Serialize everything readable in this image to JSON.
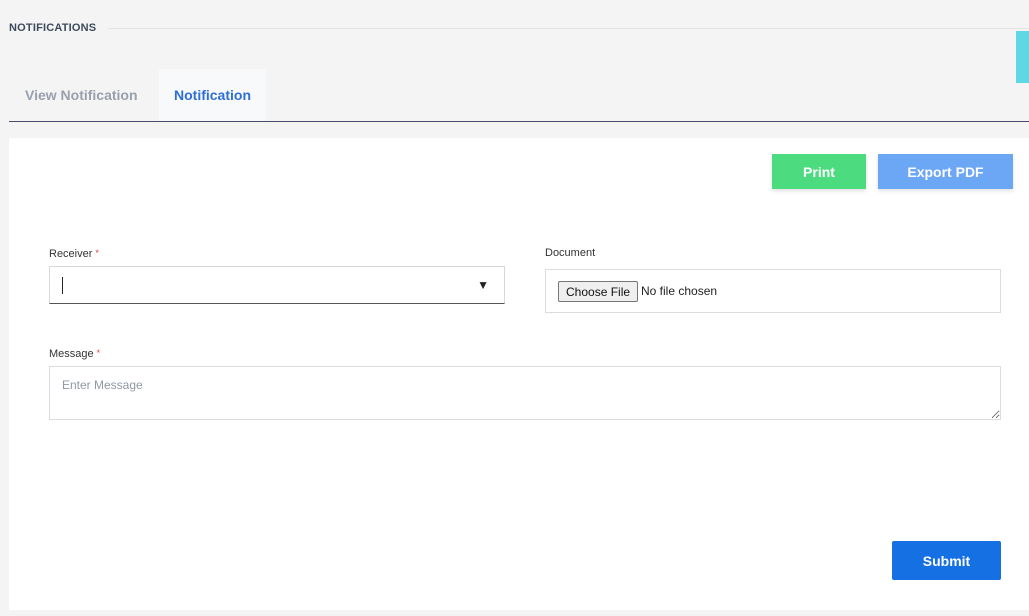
{
  "header": {
    "title": "NOTIFICATIONS"
  },
  "tabs": [
    {
      "label": "View Notification",
      "active": false
    },
    {
      "label": "Notification",
      "active": true
    }
  ],
  "toolbar": {
    "print_label": "Print",
    "export_label": "Export PDF"
  },
  "form": {
    "receiver_label": "Receiver",
    "required_mark": "*",
    "receiver_value": "",
    "document_label": "Document",
    "choose_file_label": "Choose File",
    "file_status": "No file chosen",
    "message_label": "Message",
    "message_placeholder": "Enter Message",
    "submit_label": "Submit"
  },
  "colors": {
    "print": "#4cdb7f",
    "export": "#6ca7f5",
    "submit": "#1570e3",
    "active_tab": "#2d6fd6",
    "side_handle": "#5fd8e6"
  }
}
